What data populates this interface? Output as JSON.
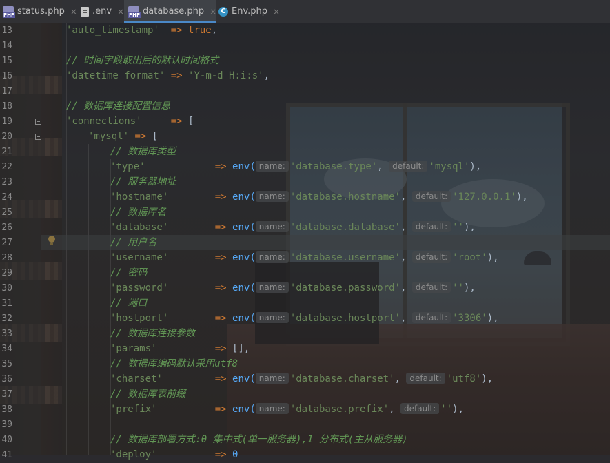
{
  "tabs": [
    {
      "label": "status.php",
      "icon": "php-file-icon",
      "active": false
    },
    {
      "label": ".env",
      "icon": "env-file-icon",
      "active": false
    },
    {
      "label": "database.php",
      "icon": "php-file-icon",
      "active": true
    },
    {
      "label": "Env.php",
      "icon": "class-file-icon",
      "active": false
    }
  ],
  "tab_close_glyph": "×",
  "php_badge": "PHP",
  "class_badge": "C",
  "accent_color": "#4a88c7",
  "line_numbers": [
    "13",
    "14",
    "15",
    "16",
    "17",
    "18",
    "19",
    "20",
    "21",
    "22",
    "23",
    "24",
    "25",
    "26",
    "27",
    "28",
    "29",
    "30",
    "31",
    "32",
    "33",
    "34",
    "35",
    "36",
    "37",
    "38",
    "39",
    "40",
    "41"
  ],
  "hint_name": "name:",
  "hint_default": "default:",
  "code": {
    "l13": {
      "key": "'auto_timestamp'",
      "arrow": "=>",
      "val": "true",
      "end": ","
    },
    "l15": {
      "comment": "// 时间字段取出后的默认时间格式"
    },
    "l16": {
      "key": "'datetime_format'",
      "arrow": "=>",
      "val": "'Y-m-d H:i:s'",
      "end": ","
    },
    "l18": {
      "comment": "// 数据库连接配置信息"
    },
    "l19": {
      "key": "'connections'",
      "arrow": "=>",
      "end": "["
    },
    "l20": {
      "key": "'mysql'",
      "arrow": "=>",
      "end": "["
    },
    "l21": {
      "comment": "// 数据库类型"
    },
    "l22": {
      "key": "'type'",
      "arrow": "=>",
      "fn": "env(",
      "name": "'database.type'",
      "sep": ",",
      "def": "'mysql'",
      "end": "),"
    },
    "l23": {
      "comment": "// 服务器地址"
    },
    "l24": {
      "key": "'hostname'",
      "arrow": "=>",
      "fn": "env(",
      "name": "'database.hostname'",
      "sep": ",",
      "def": "'127.0.0.1'",
      "end": "),"
    },
    "l25": {
      "comment": "// 数据库名"
    },
    "l26": {
      "key": "'database'",
      "arrow": "=>",
      "fn": "env(",
      "name": "'database.database'",
      "sep": ",",
      "def": "''",
      "end": "),"
    },
    "l27": {
      "comment": "// 用户名"
    },
    "l28": {
      "key": "'username'",
      "arrow": "=>",
      "fn": "env(",
      "name": "'database.username'",
      "sep": ",",
      "def": "'root'",
      "end": "),"
    },
    "l29": {
      "comment": "// 密码"
    },
    "l30": {
      "key": "'password'",
      "arrow": "=>",
      "fn": "env(",
      "name": "'database.password'",
      "sep": ",",
      "def": "''",
      "end": "),"
    },
    "l31": {
      "comment": "// 端口"
    },
    "l32": {
      "key": "'hostport'",
      "arrow": "=>",
      "fn": "env(",
      "name": "'database.hostport'",
      "sep": ",",
      "def": "'3306'",
      "end": "),"
    },
    "l33": {
      "comment": "// 数据库连接参数"
    },
    "l34": {
      "key": "'params'",
      "arrow": "=>",
      "val": "[]",
      "end": ","
    },
    "l35": {
      "comment": "// 数据库编码默认采用utf8"
    },
    "l36": {
      "key": "'charset'",
      "arrow": "=>",
      "fn": "env(",
      "name": "'database.charset'",
      "sep": ",",
      "def": "'utf8'",
      "end": "),"
    },
    "l37": {
      "comment": "// 数据库表前缀"
    },
    "l38": {
      "key": "'prefix'",
      "arrow": "=>",
      "fn": "env(",
      "name": "'database.prefix'",
      "sep": ",",
      "def": "''",
      "end": "),"
    },
    "l40": {
      "comment": "// 数据库部署方式:0 集中式(单一服务器),1 分布式(主从服务器)"
    },
    "l41": {
      "key": "'deploy'",
      "arrow": "=>",
      "val": "0"
    }
  }
}
